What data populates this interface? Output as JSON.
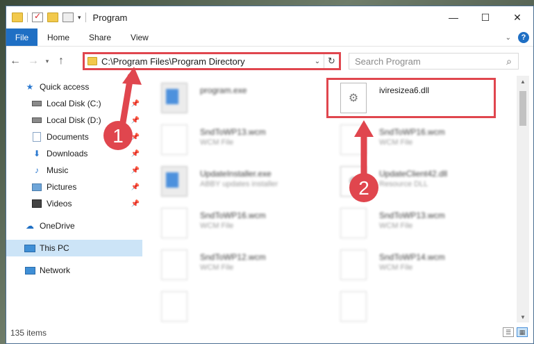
{
  "window": {
    "title": "Program"
  },
  "ribbon": {
    "tabs": [
      "File",
      "Home",
      "Share",
      "View"
    ]
  },
  "address_bar": {
    "path": "C:\\Program Files\\Program Directory"
  },
  "search": {
    "placeholder": "Search Program"
  },
  "sidebar": {
    "items": [
      {
        "label": "Quick access",
        "icon": "star-icon"
      },
      {
        "label": "Local Disk (C:)",
        "icon": "drive-icon",
        "pinned": true
      },
      {
        "label": "Local Disk (D:)",
        "icon": "drive-icon",
        "pinned": true
      },
      {
        "label": "Documents",
        "icon": "documents-icon",
        "pinned": true
      },
      {
        "label": "Downloads",
        "icon": "downloads-icon",
        "pinned": true
      },
      {
        "label": "Music",
        "icon": "music-icon",
        "pinned": true
      },
      {
        "label": "Pictures",
        "icon": "pictures-icon",
        "pinned": true
      },
      {
        "label": "Videos",
        "icon": "videos-icon",
        "pinned": true
      },
      {
        "label": "OneDrive",
        "icon": "cloud-icon"
      },
      {
        "label": "This PC",
        "icon": "computer-icon",
        "selected": true
      },
      {
        "label": "Network",
        "icon": "network-icon"
      }
    ]
  },
  "files": [
    {
      "name": "program.exe",
      "type": "",
      "icon": "exe-icon",
      "blurred": true
    },
    {
      "name": "iviresizea6.dll",
      "type": "",
      "icon": "dll-icon",
      "blurred": false,
      "highlighted": true
    },
    {
      "name": "SndToWP13.wcm",
      "type": "WCM File",
      "icon": "file-icon",
      "blurred": true
    },
    {
      "name": "SndToWP16.wcm",
      "type": "WCM File",
      "icon": "file-icon",
      "blurred": true
    },
    {
      "name": "UpdateInstaller.exe",
      "type": "ABBY updates installer",
      "icon": "exe-icon",
      "blurred": true
    },
    {
      "name": "UpdateClient42.dll",
      "type": "Resource DLL",
      "icon": "dll-icon",
      "blurred": true
    },
    {
      "name": "SndToWP16.wcm",
      "type": "WCM File",
      "icon": "file-icon",
      "blurred": true
    },
    {
      "name": "SndToWP13.wcm",
      "type": "WCM File",
      "icon": "file-icon",
      "blurred": true
    },
    {
      "name": "SndToWP12.wcm",
      "type": "WCM File",
      "icon": "file-icon",
      "blurred": true
    },
    {
      "name": "SndToWP14.wcm",
      "type": "WCM File",
      "icon": "file-icon",
      "blurred": true
    },
    {
      "name": "",
      "type": "",
      "icon": "file-icon",
      "blurred": true
    },
    {
      "name": "",
      "type": "",
      "icon": "file-icon",
      "blurred": true
    }
  ],
  "status": {
    "item_count": "135 items"
  },
  "annotations": {
    "step1": "1",
    "step2": "2",
    "color": "#e0464e"
  }
}
